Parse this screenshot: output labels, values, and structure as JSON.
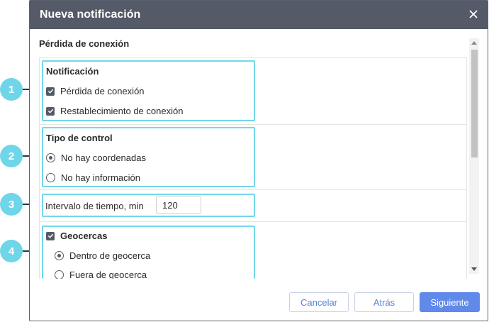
{
  "dialog": {
    "title": "Nueva notificación",
    "section_title": "Pérdida de conexión"
  },
  "notificacion": {
    "title": "Notificación",
    "options": [
      {
        "label": "Pérdida de conexión",
        "checked": true
      },
      {
        "label": "Restablecimiento de conexión",
        "checked": true
      }
    ]
  },
  "tipo_control": {
    "title": "Tipo de control",
    "options": [
      {
        "label": "No hay coordenadas",
        "selected": true
      },
      {
        "label": "No hay información",
        "selected": false
      }
    ]
  },
  "intervalo": {
    "label": "Intervalo de tiempo, min",
    "value": "120"
  },
  "geocercas": {
    "label": "Geocercas",
    "checked": true,
    "options": [
      {
        "label": "Dentro de geocerca",
        "selected": true
      },
      {
        "label": "Fuera de geocerca",
        "selected": false
      }
    ]
  },
  "buttons": {
    "cancel": "Cancelar",
    "back": "Atrás",
    "next": "Siguiente"
  },
  "callouts": [
    "1",
    "2",
    "3",
    "4"
  ],
  "colors": {
    "titlebar": "#545a67",
    "highlight": "#72d8ea",
    "primary": "#6089ea"
  }
}
